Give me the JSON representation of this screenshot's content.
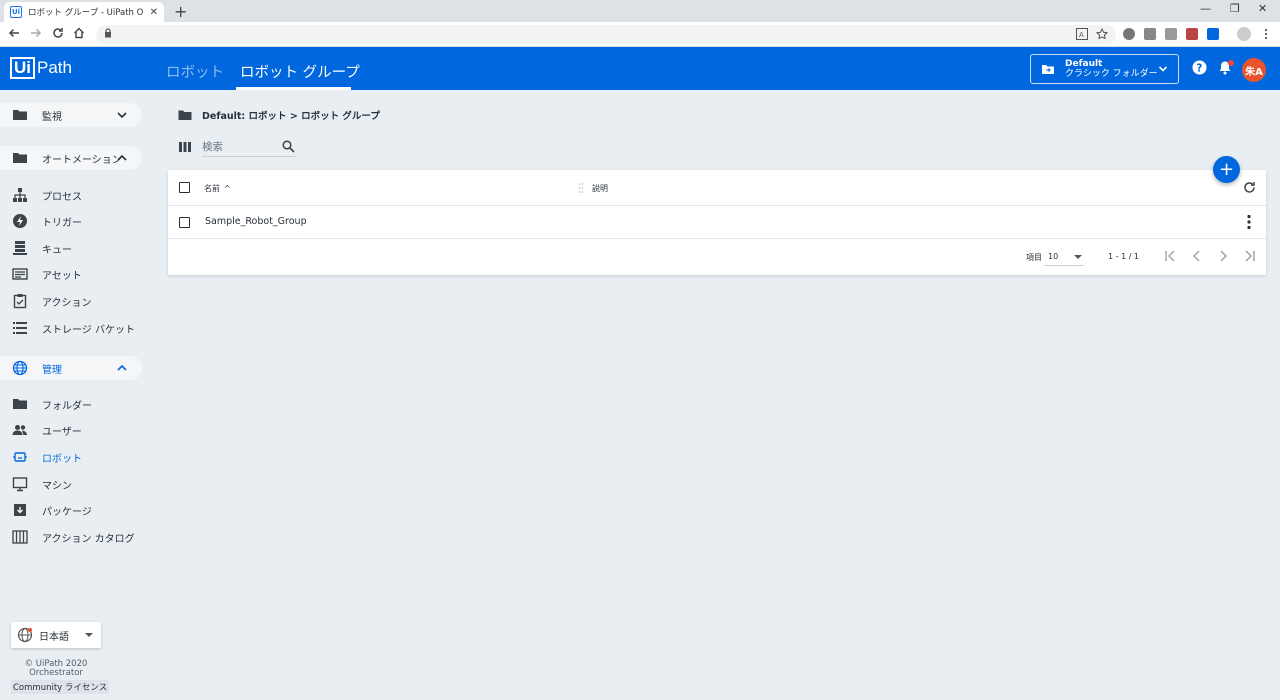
{
  "browser": {
    "tab_title": "ロボット グループ - UiPath Orchestrator",
    "tab_close": "✕",
    "new_tab": "+",
    "min": "—",
    "restore": "❐",
    "close": "✕"
  },
  "header": {
    "logo_box": "Ui",
    "logo_text": "Path",
    "tabs": [
      {
        "label": "ロボット"
      },
      {
        "label": "ロボット グループ"
      }
    ],
    "folder_line1": "Default",
    "folder_line2": "クラシック フォルダー",
    "avatar": "朱A"
  },
  "sidebar": {
    "monitor": "監視",
    "automation": "オートメーション",
    "automation_items": [
      {
        "label": "プロセス"
      },
      {
        "label": "トリガー"
      },
      {
        "label": "キュー"
      },
      {
        "label": "アセット"
      },
      {
        "label": "アクション"
      },
      {
        "label": "ストレージ バケット"
      }
    ],
    "admin": "管理",
    "admin_items": [
      {
        "label": "フォルダー"
      },
      {
        "label": "ユーザー"
      },
      {
        "label": "ロボット"
      },
      {
        "label": "マシン"
      },
      {
        "label": "パッケージ"
      },
      {
        "label": "アクション カタログ"
      }
    ],
    "language": "日本語",
    "copyright": "© UiPath 2020",
    "product": "Orchestrator",
    "license": "Community ライセンス"
  },
  "main": {
    "breadcrumb": "Default: ロボット > ロボット グループ",
    "search_placeholder": "検索",
    "fab": "+",
    "columns": {
      "name": "名前",
      "sort": "^",
      "description": "説明"
    },
    "rows": [
      {
        "name": "Sample_Robot_Group"
      }
    ],
    "pager": {
      "items_label": "項目",
      "page_size": "10",
      "range": "1 - 1 / 1"
    }
  },
  "colors": {
    "brand": "#0067df",
    "avatar": "#e8542e",
    "background": "#e9eef2"
  }
}
